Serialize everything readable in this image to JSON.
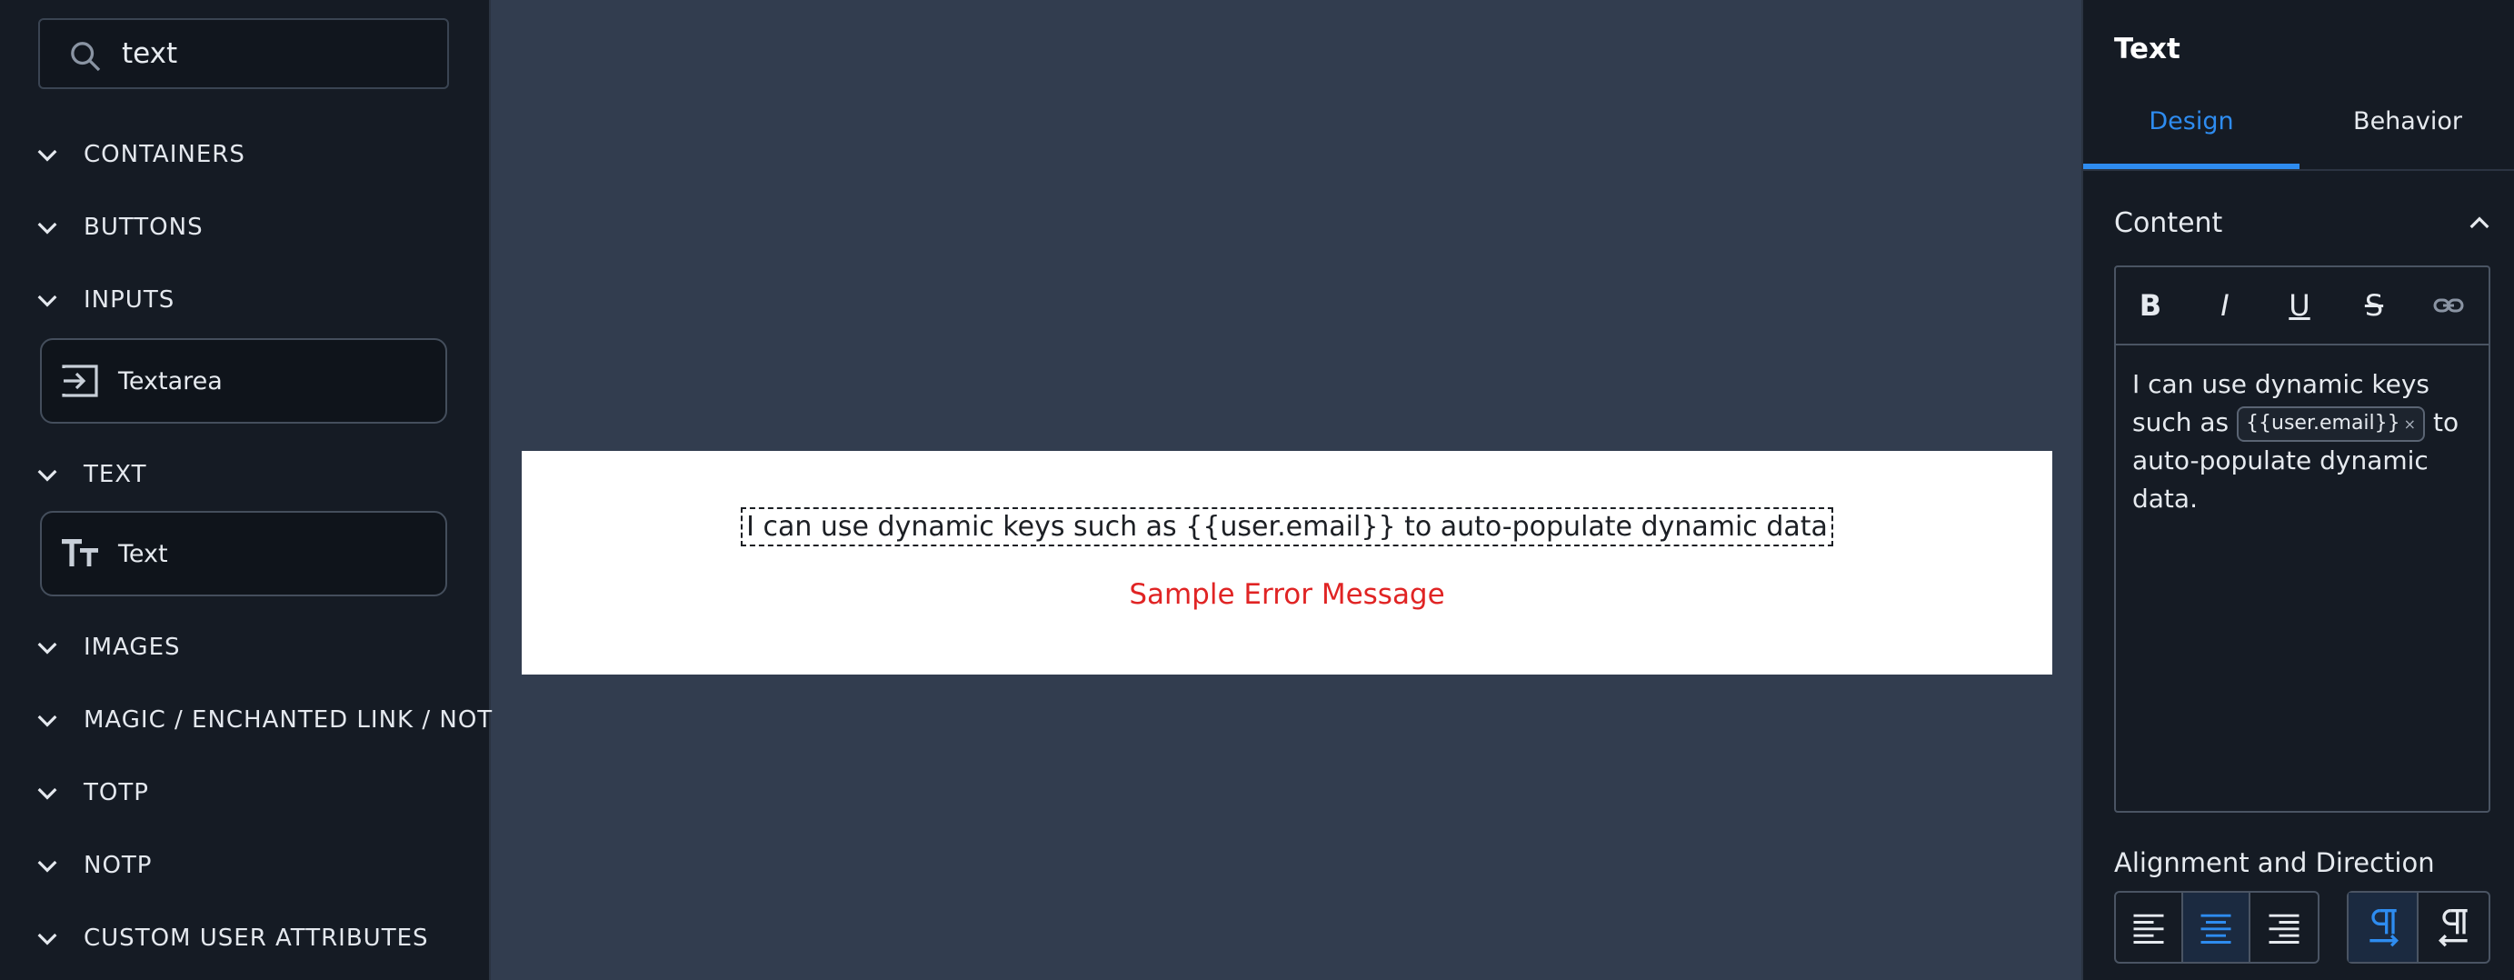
{
  "search": {
    "value": "text"
  },
  "categories": {
    "containers": "CONTAINERS",
    "buttons": "BUTTONS",
    "inputs": "INPUTS",
    "text": "TEXT",
    "images": "IMAGES",
    "magic": "MAGIC / ENCHANTED LINK / NOTP",
    "totp": "TOTP",
    "notp": "NOTP",
    "custom": "CUSTOM USER ATTRIBUTES"
  },
  "components": {
    "textarea": "Textarea",
    "text": "Text"
  },
  "canvas": {
    "text": "I can use dynamic keys such as {{user.email}} to auto-populate dynamic data",
    "error": "Sample Error Message"
  },
  "panel": {
    "title": "Text",
    "tabs": {
      "design": "Design",
      "behavior": "Behavior"
    },
    "content_title": "Content",
    "toolbar": {
      "bold": "B",
      "italic": "I",
      "underline": "U",
      "strike": "S"
    },
    "editor": {
      "before": "I can use dynamic keys such as ",
      "chip": "{{user.email}}",
      "chip_remove": "×",
      "after": " to auto-populate dynamic data."
    },
    "alignment_title": "Alignment and Direction"
  },
  "colors": {
    "accent": "#2e8cf0",
    "error": "#e02424",
    "canvas_bg": "#323d4f",
    "panel_bg": "#151b24"
  }
}
